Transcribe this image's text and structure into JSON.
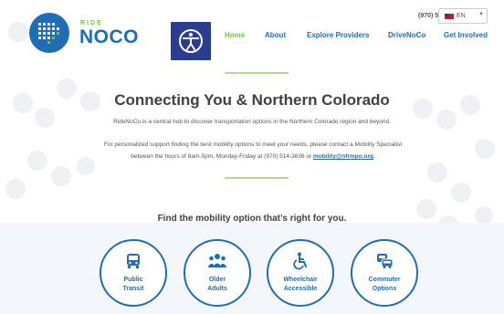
{
  "header": {
    "logo_ride": "RIDE",
    "logo_noco": "NOCO",
    "phone": "(970) 514-3636",
    "language": {
      "flag": "us-flag-icon",
      "label": "EN"
    },
    "accessibility_icon": "accessibility-icon"
  },
  "nav": {
    "items": [
      {
        "label": "Home",
        "active": true
      },
      {
        "label": "About",
        "active": false
      },
      {
        "label": "Explore Providers",
        "active": false
      },
      {
        "label": "DriveNoCo",
        "active": false
      },
      {
        "label": "Get Involved",
        "active": false
      }
    ]
  },
  "intro": {
    "title": "Connecting You & Northern Colorado",
    "paragraph1": "RideNoCo is a central hub to discover transportation options in the Northern Colorado region and beyond.",
    "paragraph2_text": "For personalized support finding the best mobility options to meet your needs, please contact a Mobility Specialist between the hours of 8am-5pm, Monday-Friday at (970) 514-3636 or ",
    "paragraph2_link": "mobility@nfrmpo.org",
    "paragraph2_end": "."
  },
  "options": {
    "heading": "Find the mobility option that’s right for you.",
    "cards": [
      {
        "line1": "Public",
        "line2": "Transit",
        "icon": "bus-icon"
      },
      {
        "line1": "Older",
        "line2": "Adults",
        "icon": "group-icon"
      },
      {
        "line1": "Wheelchair",
        "line2": "Accessible",
        "icon": "wheelchair-icon"
      },
      {
        "line1": "Commuter",
        "line2": "Options",
        "icon": "van-icon"
      }
    ]
  },
  "colors": {
    "brand_blue": "#1e6db6",
    "brand_green": "#7ac142",
    "accessibility_navy": "#2a3e91"
  }
}
